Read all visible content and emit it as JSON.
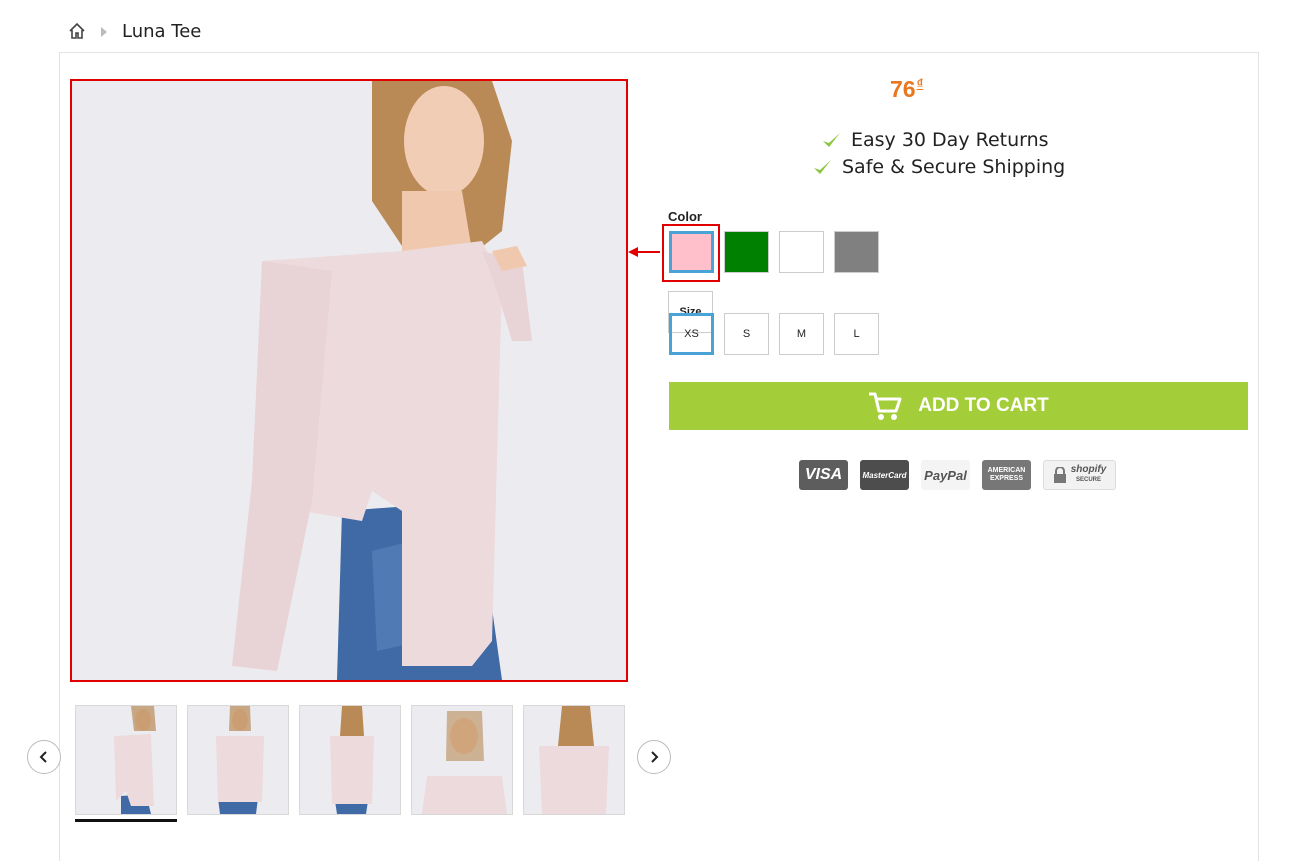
{
  "breadcrumb": {
    "home_icon": "home-icon",
    "current": "Luna Tee"
  },
  "product": {
    "price": "76",
    "currency": "₫",
    "perks": [
      "Easy 30 Day Returns",
      "Safe & Secure Shipping"
    ]
  },
  "options": {
    "color_label": "Color",
    "colors": [
      {
        "name": "pink",
        "hex": "#ffc0cb",
        "selected": true
      },
      {
        "name": "green",
        "hex": "#008000",
        "selected": false
      },
      {
        "name": "white",
        "hex": "#ffffff",
        "selected": false
      },
      {
        "name": "gray",
        "hex": "#808080",
        "selected": false
      }
    ],
    "size_label": "Size",
    "sizes": [
      "XS",
      "S",
      "M",
      "L"
    ],
    "selected_size": "XS"
  },
  "cart": {
    "label": "ADD TO CART"
  },
  "payments": {
    "visa": "VISA",
    "mastercard": "MasterCard",
    "paypal": "PayPal",
    "amex_line1": "AMERICAN",
    "amex_line2": "EXPRESS",
    "shopify": "shopify",
    "shopify_sub": "SECURE"
  },
  "colors": {
    "price": "#e8771f",
    "cart_button": "#a3cd39",
    "check": "#8cc63f",
    "selected_border": "#4aa3d6",
    "highlight": "#e00000"
  }
}
